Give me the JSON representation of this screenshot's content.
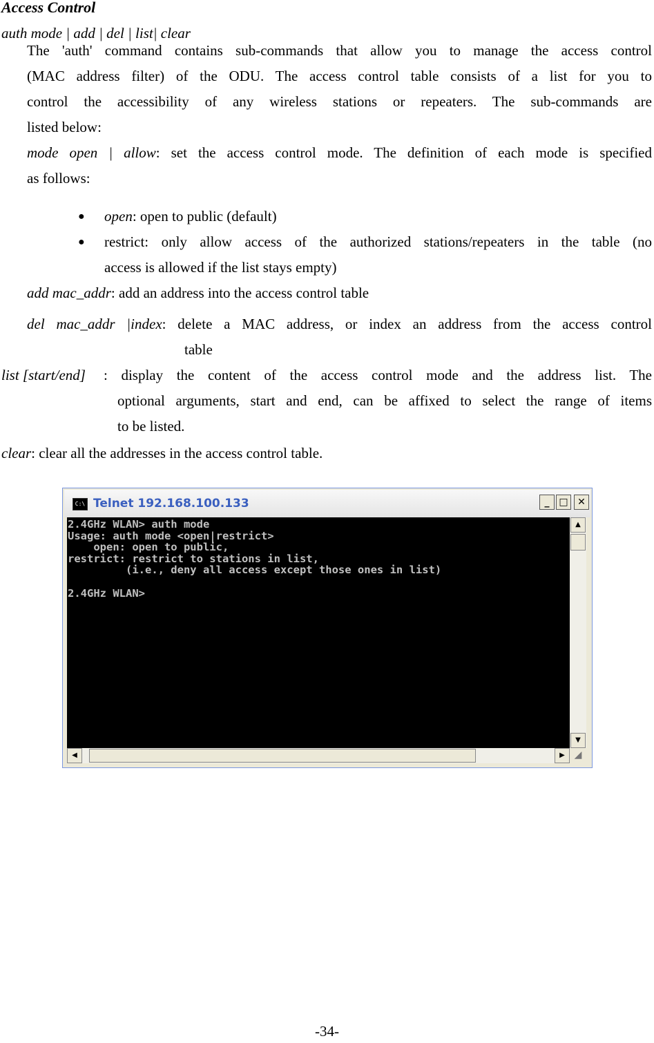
{
  "heading": "Access Control",
  "command_line": "auth mode | add | del | list| clear",
  "intro": [
    "The 'auth' command contains sub-commands that allow you to manage the access control",
    "(MAC address filter) of the ODU. The access control table consists of a list for you to",
    "control the accessibility of any wireless stations or repeaters.  The sub-commands are",
    "listed below:"
  ],
  "mode": {
    "term": "mode open | allow",
    "desc_line1": ": set the access control mode.  The definition of each mode is specified",
    "desc_line2": "as follows:"
  },
  "bullets": [
    {
      "term": "open",
      "lines": [
        ": open to public (default)"
      ]
    },
    {
      "term": "",
      "lines": [
        "restrict: only allow access of the authorized stations/repeaters in the table (no",
        "access is allowed if the list stays empty)"
      ]
    }
  ],
  "add": {
    "term": "add mac_addr",
    "desc": ": add an address into the access control table"
  },
  "del": {
    "term": "del mac_addr |index",
    "desc_line1": ": delete a MAC address, or index an address from the access control",
    "desc_line2": "table"
  },
  "list": {
    "term": "list [start/end]",
    "desc_line1": ": display the content of the access control mode and the address list.  The",
    "desc_line2": "optional arguments, start and end, can be affixed to select the range of items",
    "desc_line3": "to be listed."
  },
  "clear": {
    "term": "clear",
    "desc": ": clear all the addresses in the access control table."
  },
  "telnet": {
    "icon_text": "C:\\",
    "title": "Telnet 192.168.100.133",
    "minimize": "_",
    "maximize": "□",
    "close": "✕",
    "console_lines": [
      "2.4GHz WLAN> auth mode",
      "Usage: auth mode <open|restrict>",
      "    open: open to public,",
      "restrict: restrict to stations in list,",
      "         (i.e., deny all access except those ones in list)",
      "",
      "2.4GHz WLAN>"
    ],
    "scroll_up": "▲",
    "scroll_down": "▼",
    "scroll_left": "◀",
    "scroll_right": "▶"
  },
  "page_number": "-34-"
}
